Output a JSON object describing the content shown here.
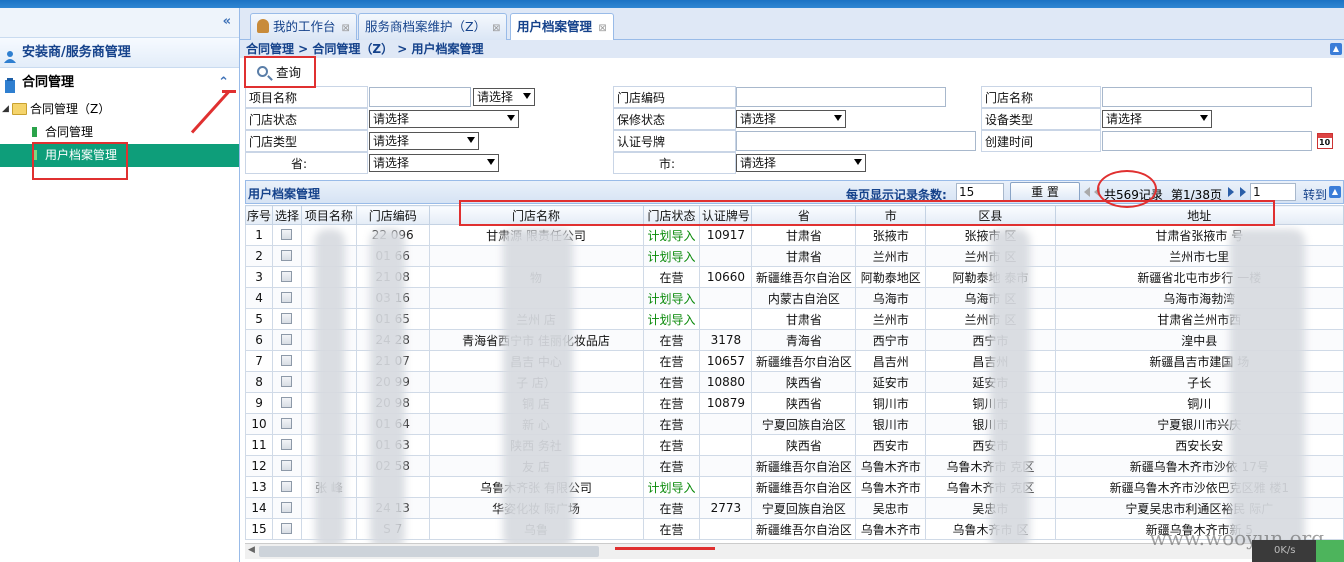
{
  "sidebar": {
    "collapse_glyph": "«",
    "section1": "安装商/服务商管理",
    "section2": "合同管理",
    "tree": {
      "folder": "合同管理（Z）",
      "item1": "合同管理",
      "item2": "用户档案管理"
    }
  },
  "tabs": [
    {
      "label": "我的工作台"
    },
    {
      "label": "服务商档案维护（Z）"
    },
    {
      "label": "用户档案管理"
    }
  ],
  "breadcrumb": "合同管理 > 合同管理（Z） > 用户档案管理",
  "toolbar": {
    "query_label": "查询"
  },
  "form": {
    "project_name": "项目名称",
    "project_select": "请选择",
    "store_code": "门店编码",
    "store_name": "门店名称",
    "store_status": "门店状态",
    "store_status_select": "请选择",
    "warranty_status": "保修状态",
    "warranty_select": "请选择",
    "device_type": "设备类型",
    "device_select": "请选择",
    "store_type": "门店类型",
    "store_type_select": "请选择",
    "cert_plate": "认证号牌",
    "created_time": "创建时间",
    "calendar_label": "10",
    "province": "省:",
    "province_select": "请选择",
    "city": "市:",
    "city_select": "请选择"
  },
  "gridbar": {
    "title": "用户档案管理",
    "per_page_label": "每页显示记录条数:",
    "per_page_value": "15",
    "reset_label": "重 置",
    "total": "共569记录",
    "page": "第1/38页",
    "goto_value": "1",
    "goto_label": "转到"
  },
  "table": {
    "headers": [
      "序号",
      "选择",
      "项目名称",
      "门店编码",
      "门店名称",
      "门店状态",
      "认证牌号",
      "省",
      "市",
      "区县",
      "地址"
    ],
    "rows": [
      [
        "1",
        "",
        "",
        "22  096",
        "甘肃源  限责任公司",
        "计划导入",
        "10917",
        "甘肃省",
        "张掖市",
        "张掖市  区",
        "甘肃省张掖市  号"
      ],
      [
        "2",
        "",
        "",
        "01  66",
        "",
        "计划导入",
        "",
        "甘肃省",
        "兰州市",
        "兰州市  区",
        "兰州市七里  "
      ],
      [
        "3",
        "",
        "",
        "21  08",
        "  物",
        "在营",
        "10660",
        "新疆维吾尔自治区",
        "阿勒泰地区",
        "阿勒泰地  泰市",
        "新疆省北屯市步行  一楼"
      ],
      [
        "4",
        "",
        "",
        "03  16",
        "",
        "计划导入",
        "",
        "内蒙古自治区",
        "乌海市",
        "乌海市  区",
        "乌海市海勃湾  "
      ],
      [
        "5",
        "",
        "",
        "01  65",
        "兰州  店",
        "计划导入",
        "",
        "甘肃省",
        "兰州市",
        "兰州市  区",
        "甘肃省兰州市西  "
      ],
      [
        "6",
        "",
        "",
        "24  28",
        "青海省西宁市  佳丽化妆品店",
        "在营",
        "3178",
        "青海省",
        "西宁市",
        "西宁市  ",
        "湟中县  "
      ],
      [
        "7",
        "",
        "",
        "21  07",
        "昌吉  中心",
        "在营",
        "10657",
        "新疆维吾尔自治区",
        "昌吉州",
        "昌吉州  ",
        "新疆昌吉市建国  场"
      ],
      [
        "8",
        "",
        "",
        "20  99",
        "子  店）",
        "在营",
        "10880",
        "陕西省",
        "延安市",
        "延安市  ",
        "子长  "
      ],
      [
        "9",
        "",
        "",
        "20  98",
        "铜  店",
        "在营",
        "10879",
        "陕西省",
        "铜川市",
        "铜川市  ",
        "铜川  "
      ],
      [
        "10",
        "",
        "",
        "01  64",
        "新  心",
        "在营",
        "",
        "宁夏回族自治区",
        "银川市",
        "银川市  ",
        "宁夏银川市兴庆  "
      ],
      [
        "11",
        "",
        "",
        "01  63",
        "陕西  务社",
        "在营",
        "",
        "陕西省",
        "西安市",
        "西安市  ",
        "西安长安  "
      ],
      [
        "12",
        "",
        "",
        "02  58",
        "友  店",
        "在营",
        "",
        "新疆维吾尔自治区",
        "乌鲁木齐市",
        "乌鲁木齐市  克区",
        "新疆乌鲁木齐市沙依  17号"
      ],
      [
        "13",
        "",
        "张  峰",
        "",
        "乌鲁木齐张  有限公司",
        "计划导入",
        "",
        "新疆维吾尔自治区",
        "乌鲁木齐市",
        "乌鲁木齐市  克区",
        "新疆乌鲁木齐市沙依巴克区雅  楼1"
      ],
      [
        "14",
        "",
        "",
        "24  13",
        "华姿化妆  际广场",
        "在营",
        "2773",
        "宁夏回族自治区",
        "吴忠市",
        "吴忠市  ",
        "宁夏吴忠市利通区裕民  际广"
      ],
      [
        "15",
        "",
        "",
        "S  7",
        "乌鲁  ",
        "在营",
        "",
        "新疆维吾尔自治区",
        "乌鲁木齐市",
        "乌鲁木齐市  区",
        "新疆乌鲁木齐市新  5"
      ]
    ]
  },
  "watermark": "www.wooyun.org",
  "netmeter": "0K/s"
}
